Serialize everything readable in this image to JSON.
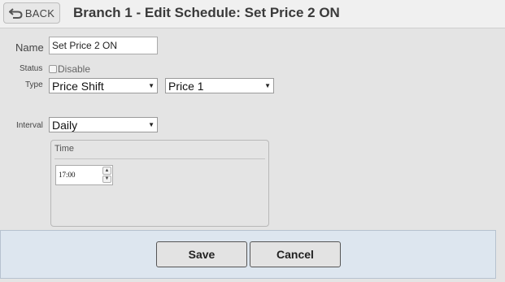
{
  "header": {
    "back_label": "BACK",
    "title": "Branch 1 - Edit Schedule: Set Price 2 ON"
  },
  "form": {
    "name_label": "Name",
    "name_value": "Set Price 2 ON",
    "status_label": "Status",
    "disable_label": "Disable",
    "disable_checked": false,
    "type_label": "Type",
    "type_value": "Price Shift",
    "price_value": "Price 1",
    "interval_label": "Interval",
    "interval_value": "Daily",
    "time_group_label": "Time",
    "time_value": "17:00"
  },
  "footer": {
    "save_label": "Save",
    "cancel_label": "Cancel"
  },
  "icons": {
    "back": "back-arrow-icon",
    "dropdown": "chevron-down-icon",
    "spin_up": "spin-up-icon",
    "spin_down": "spin-down-icon"
  },
  "colors": {
    "background": "#e4e4e4",
    "header": "#f0f0f0",
    "footer": "#dde6ef",
    "footer_border": "#b6c2cf"
  }
}
